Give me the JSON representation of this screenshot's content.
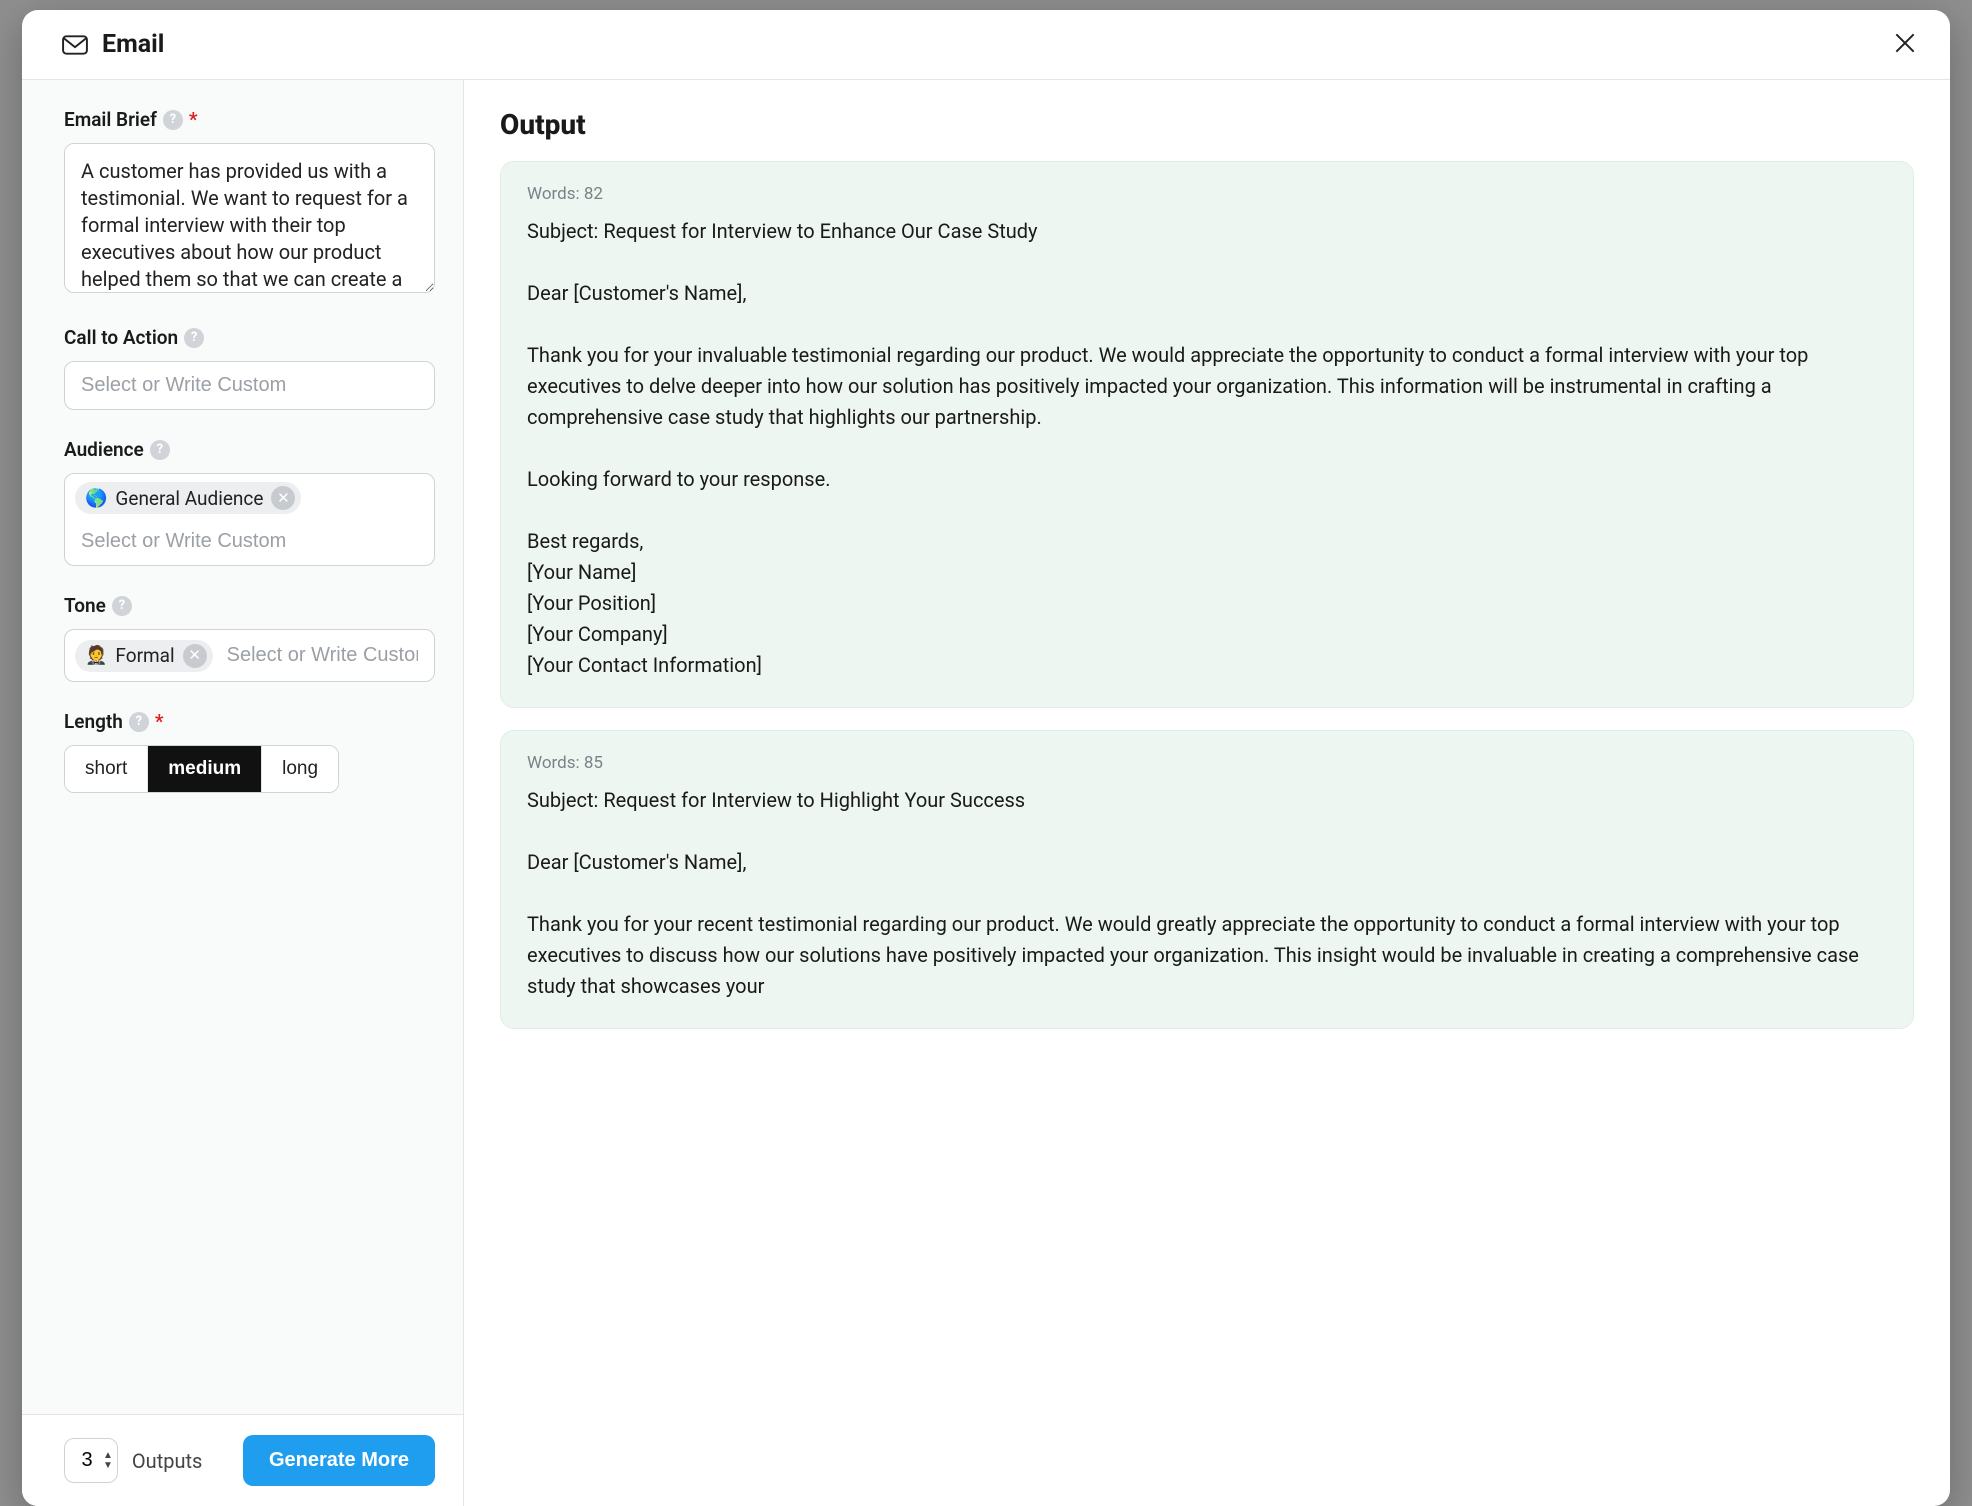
{
  "modal": {
    "title": "Email"
  },
  "form": {
    "email_brief": {
      "label": "Email Brief",
      "required": true,
      "value": "A customer has provided us with a testimonial. We want to request for a formal interview with their top executives about how our product helped them so that we can create a case study."
    },
    "cta": {
      "label": "Call to Action",
      "placeholder": "Select or Write Custom",
      "value": ""
    },
    "audience": {
      "label": "Audience",
      "placeholder": "Select or Write Custom",
      "chips": [
        {
          "emoji": "🌎",
          "text": "General Audience"
        }
      ]
    },
    "tone": {
      "label": "Tone",
      "placeholder": "Select or Write Custom",
      "chips": [
        {
          "emoji": "🤵",
          "text": "Formal"
        }
      ]
    },
    "length": {
      "label": "Length",
      "required": true,
      "options": [
        "short",
        "medium",
        "long"
      ],
      "selected": "medium"
    }
  },
  "footer": {
    "outputs_count": "3",
    "outputs_label": "Outputs",
    "generate_label": "Generate More"
  },
  "output": {
    "title": "Output",
    "words_prefix": "Words: ",
    "results": [
      {
        "words": "82",
        "subject": "Subject: Request for Interview to Enhance Our Case Study",
        "body": "Dear [Customer's Name],\n\nThank you for your invaluable testimonial regarding our product. We would appreciate the opportunity to conduct a formal interview with your top executives to delve deeper into how our solution has positively impacted your organization. This information will be instrumental in crafting a comprehensive case study that highlights our partnership.\n\nLooking forward to your response.\n\nBest regards,\n[Your Name]\n[Your Position]\n[Your Company]\n[Your Contact Information]"
      },
      {
        "words": "85",
        "subject": "Subject: Request for Interview to Highlight Your Success",
        "body": "Dear [Customer's Name],\n\nThank you for your recent testimonial regarding our product. We would greatly appreciate the opportunity to conduct a formal interview with your top executives to discuss how our solutions have positively impacted your organization. This insight would be invaluable in creating a comprehensive case study that showcases your"
      }
    ]
  }
}
